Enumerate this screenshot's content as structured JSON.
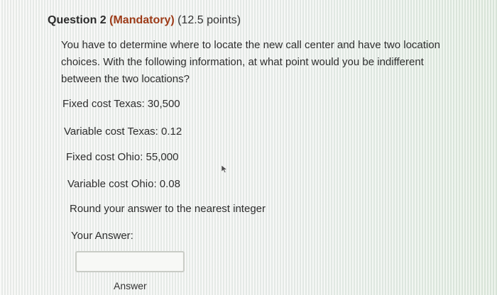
{
  "question": {
    "number_label": "Question 2",
    "mandatory_label": "(Mandatory)",
    "points_label": "(12.5 points)",
    "prompt": "You have to determine where to locate the new call center and have two location choices. With the following information, at what point would you be indifferent between the two locations?",
    "givens": [
      "Fixed cost Texas: 30,500",
      "Variable cost Texas: 0.12",
      "Fixed cost Ohio: 55,000",
      "Variable cost Ohio: 0.08"
    ],
    "instruction": "Round your answer to the nearest integer",
    "answer_prompt": "Your Answer:",
    "answer_input": {
      "value": "",
      "caption": "Answer"
    }
  },
  "colors": {
    "mandatory": "#9c3b18",
    "text": "#2e2e2e",
    "input_border": "#c9ccc6"
  },
  "icons": {
    "cursor": "mouse-pointer-icon"
  }
}
